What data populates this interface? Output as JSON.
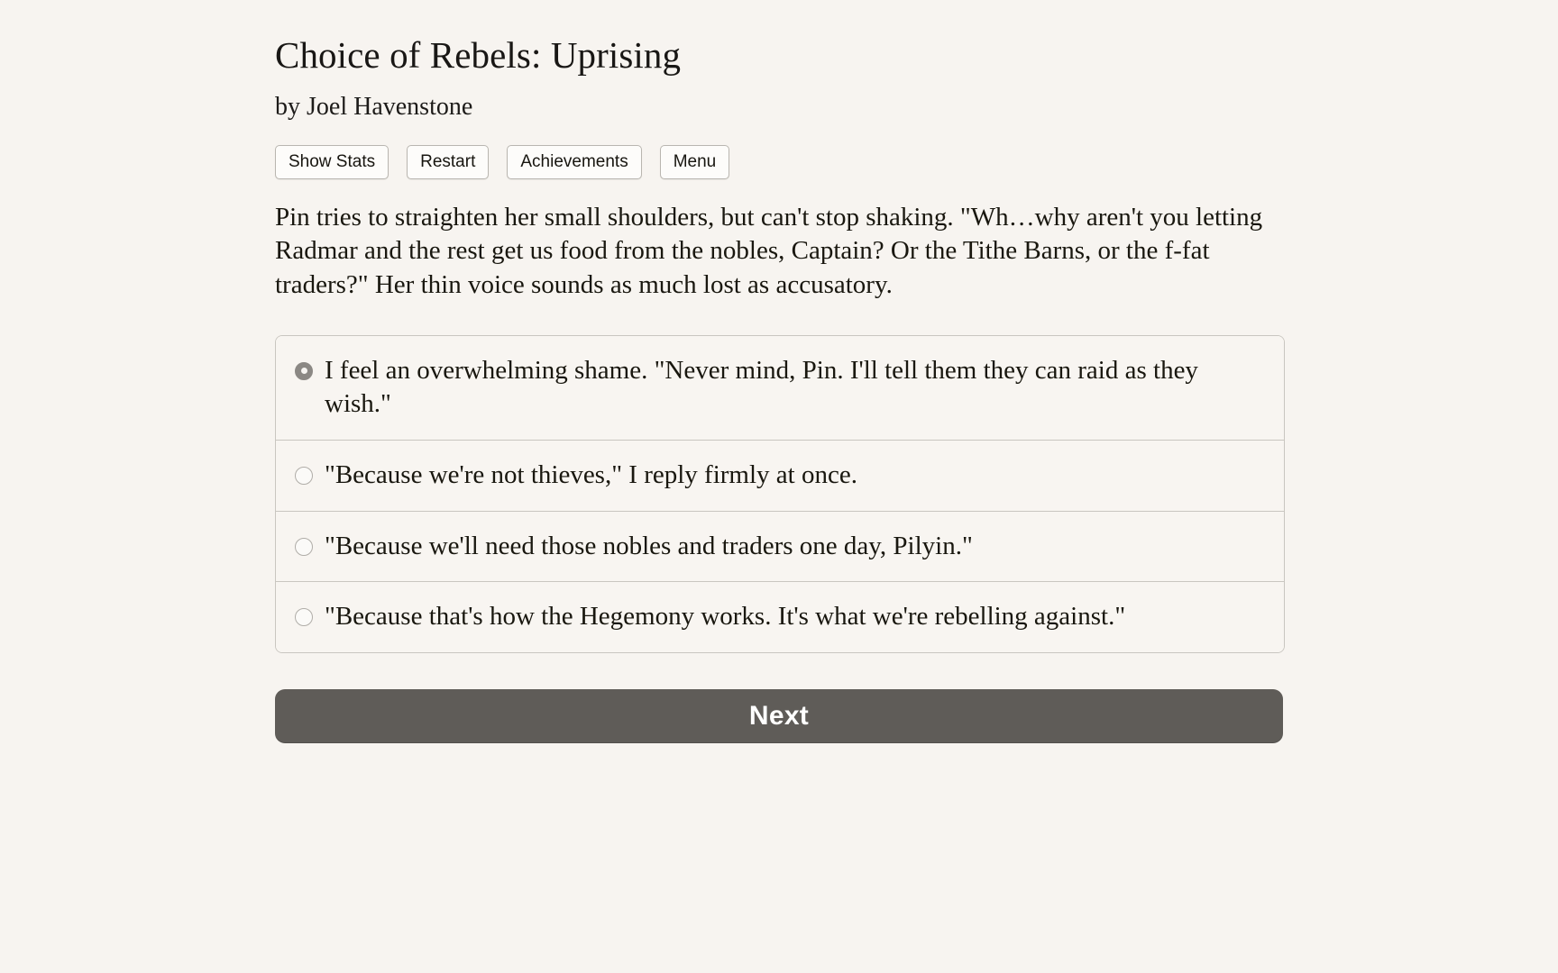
{
  "header": {
    "title": "Choice of Rebels: Uprising",
    "byline": "by Joel Havenstone"
  },
  "menu_bar": {
    "buttons": [
      {
        "label": "Show Stats",
        "name": "show-stats-button"
      },
      {
        "label": "Restart",
        "name": "restart-button"
      },
      {
        "label": "Achievements",
        "name": "achievements-button"
      },
      {
        "label": "Menu",
        "name": "menu-button"
      }
    ]
  },
  "story": {
    "paragraph": "Pin tries to straighten her small shoulders, but can't stop shaking. \"Wh…why aren't you letting Radmar and the rest get us food from the nobles, Captain? Or the Tithe Barns, or the f-fat traders?\" Her thin voice sounds as much lost as accusatory."
  },
  "choices": {
    "selected_index": 0,
    "options": [
      {
        "label": "I feel an overwhelming shame. \"Never mind, Pin. I'll tell them they can raid as they wish.\"",
        "selected": true
      },
      {
        "label": "\"Because we're not thieves,\" I reply firmly at once.",
        "selected": false
      },
      {
        "label": "\"Because we'll need those nobles and traders one day, Pilyin.\"",
        "selected": false
      },
      {
        "label": "\"Because that's how the Hegemony works. It's what we're rebelling against.\"",
        "selected": false
      }
    ]
  },
  "actions": {
    "next_label": "Next"
  },
  "colors": {
    "background": "#f7f4f0",
    "text": "#19170f",
    "next_button_bg": "#5f5c58",
    "next_button_text": "#ffffff",
    "border": "#c9c6c0",
    "radio_selected": "#8b8884"
  }
}
